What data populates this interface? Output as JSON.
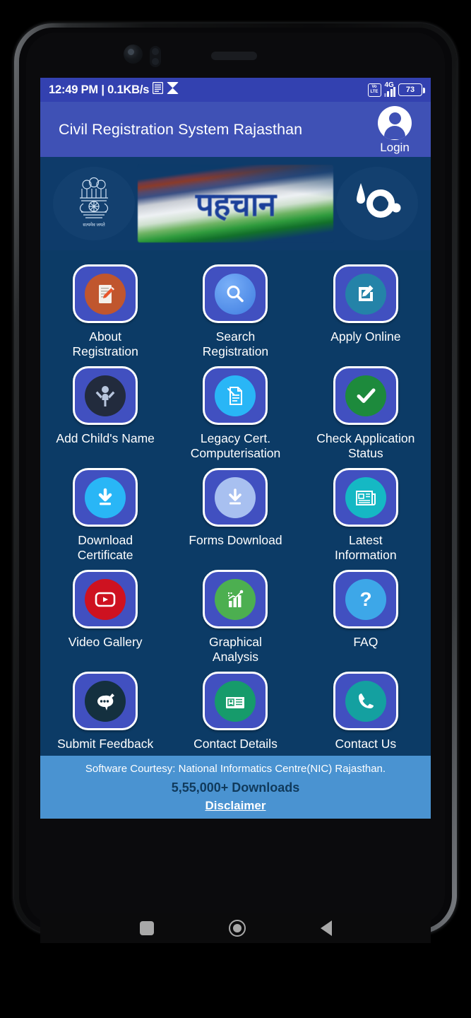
{
  "status_bar": {
    "time_and_speed": "12:49 PM | 0.1KB/s",
    "volte_line1": "Vo",
    "volte_line2": "LTE",
    "network": "4G",
    "battery_level": "73",
    "icons": [
      "document-icon",
      "app-icon",
      "volte-icon",
      "signal-icon",
      "battery-icon"
    ]
  },
  "app_bar": {
    "title": "Civil Registration System Rajasthan",
    "login_label": "Login",
    "avatar_icon": "user-avatar-icon",
    "background_color": "#3f51b5"
  },
  "banner": {
    "left_logo": "india-state-emblem-icon",
    "center_text": "पहचान",
    "right_logo": "nic-logo-icon",
    "background_color": "#0e3b6a"
  },
  "grid": {
    "background_color": "#0c3b66",
    "tile_color": "#4150c0",
    "tiles": [
      {
        "label": "About Registration",
        "icon": "about-registration-icon",
        "icon_bg": "#c0562e"
      },
      {
        "label": "Search Registration",
        "icon": "search-icon",
        "icon_bg": "#4b8ef0"
      },
      {
        "label": "Apply Online",
        "icon": "apply-online-edit-icon",
        "icon_bg": "#2483a8"
      },
      {
        "label": "Add Child's Name",
        "icon": "child-icon",
        "icon_bg": "#222b3d"
      },
      {
        "label": "Legacy Cert. Computerisation",
        "icon": "legacy-document-icon",
        "icon_bg": "#29b6f6"
      },
      {
        "label": "Check Application Status",
        "icon": "check-circle-icon",
        "icon_bg": "#1d8a3c"
      },
      {
        "label": "Download Certificate",
        "icon": "download-circle-icon",
        "icon_bg": "#29b6f6"
      },
      {
        "label": "Forms Download",
        "icon": "forms-download-icon",
        "icon_bg": "#a8c0f0"
      },
      {
        "label": "Latest Information",
        "icon": "newspaper-icon",
        "icon_bg": "#15b8c4"
      },
      {
        "label": "Video Gallery",
        "icon": "video-play-icon",
        "icon_bg": "#ce1220"
      },
      {
        "label": "Graphical Analysis",
        "icon": "bar-chart-icon",
        "icon_bg": "#4caf50"
      },
      {
        "label": "FAQ",
        "icon": "question-mark-icon",
        "icon_bg": "#3da7e8"
      },
      {
        "label": "Submit Feedback",
        "icon": "feedback-chat-icon",
        "icon_bg": "#14303f"
      },
      {
        "label": "Contact Details",
        "icon": "contact-card-icon",
        "icon_bg": "#169b6b"
      },
      {
        "label": "Contact Us",
        "icon": "phone-icon",
        "icon_bg": "#14a0a0"
      }
    ]
  },
  "footer": {
    "courtesy": "Software Courtesy: National Informatics Centre(NIC) Rajasthan.",
    "downloads": "5,55,000+ Downloads",
    "disclaimer": "Disclaimer",
    "background_color": "#4a93d1"
  },
  "nav_bar": {
    "recent_icon": "recent-apps-icon",
    "home_icon": "home-icon",
    "back_icon": "back-icon"
  }
}
